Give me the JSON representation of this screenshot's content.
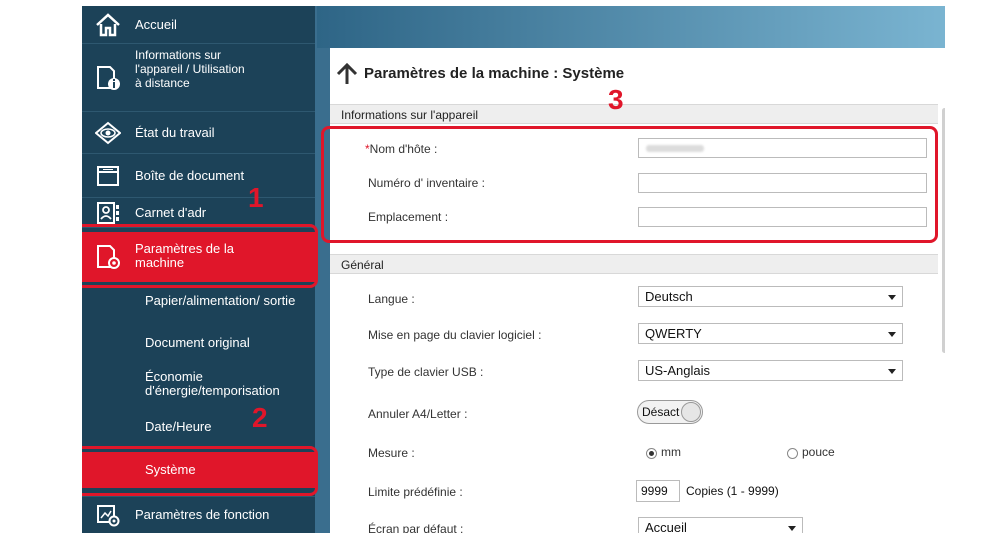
{
  "sidebar": {
    "items": [
      {
        "label": "Accueil",
        "icon": "home-icon"
      },
      {
        "label": "Informations sur l'appareil / Utilisation à distance",
        "line1": "Informations sur",
        "line2": "l'appareil / Utilisation",
        "line3": "à distance",
        "icon": "device-info-icon"
      },
      {
        "label": "État du travail",
        "icon": "eye-icon"
      },
      {
        "label": "Boîte de document",
        "icon": "folder-icon"
      },
      {
        "label": "Carnet d'adr",
        "icon": "address-book-icon"
      },
      {
        "label": "Paramètres de la machine",
        "line1": "Paramètres de la",
        "line2": "machine",
        "icon": "device-settings-icon"
      },
      {
        "label": "Paramètres de fonction",
        "icon": "function-settings-icon"
      }
    ],
    "subitems": [
      {
        "label": "Papier/alimentation/ sortie"
      },
      {
        "label": "Document original"
      },
      {
        "label": "Économie d'énergie/temporisation",
        "line1": "Économie",
        "line2": "d'énergie/temporisation"
      },
      {
        "label": "Date/Heure"
      },
      {
        "label": "Système"
      }
    ]
  },
  "main": {
    "title": "Paramètres de la machine : Système",
    "section_device": "Informations sur l'appareil",
    "hostname_label": "Nom d'hôte :",
    "hostname_required_mark": "*",
    "hostname_value": "",
    "asset_label": "Numéro d' inventaire :",
    "asset_value": "",
    "location_label": "Emplacement :",
    "location_value": "",
    "section_general": "Général",
    "language_label": "Langue :",
    "language_value": "Deutsch",
    "keyboard_layout_label": "Mise en page du clavier logiciel :",
    "keyboard_layout_value": "QWERTY",
    "usb_keyboard_label": "Type de clavier USB :",
    "usb_keyboard_value": "US-Anglais",
    "a4letter_label": "Annuler A4/Letter :",
    "a4letter_value": "Désact",
    "measure_label": "Mesure :",
    "measure_option_mm": "mm",
    "measure_option_inch": "pouce",
    "measure_selected": "mm",
    "limit_label": "Limite prédéfinie :",
    "limit_value": "9999",
    "limit_unit": "Copies (1 - 9999)",
    "default_screen_label": "Écran par défaut :",
    "default_screen_value": "Accueil"
  },
  "callouts": {
    "n1": "1",
    "n2": "2",
    "n3": "3"
  },
  "colors": {
    "accent_red": "#e0162a",
    "sidebar": "#1c4258"
  }
}
